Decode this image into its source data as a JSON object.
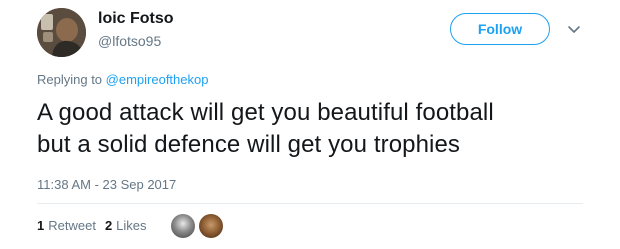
{
  "user": {
    "name": "loic Fotso",
    "handle": "@lfotso95"
  },
  "follow_button": {
    "label": "Follow",
    "color": "#1da1f2"
  },
  "menu": {
    "icon": "chevron-down-icon"
  },
  "reply": {
    "prefix": "Replying to ",
    "target": "@empireofthekop"
  },
  "tweet": {
    "lines": [
      "A good attack will get you beautiful football",
      "but a solid defence will get you trophies"
    ],
    "timestamp": "11:38 AM - 23 Sep 2017"
  },
  "stats": {
    "retweets": {
      "count": "1",
      "label": "Retweet"
    },
    "likes": {
      "count": "2",
      "label": "Likes"
    }
  },
  "colors": {
    "accent": "#1da1f2",
    "text": "#14171a",
    "muted": "#657786",
    "divider": "#e6ecf0"
  }
}
